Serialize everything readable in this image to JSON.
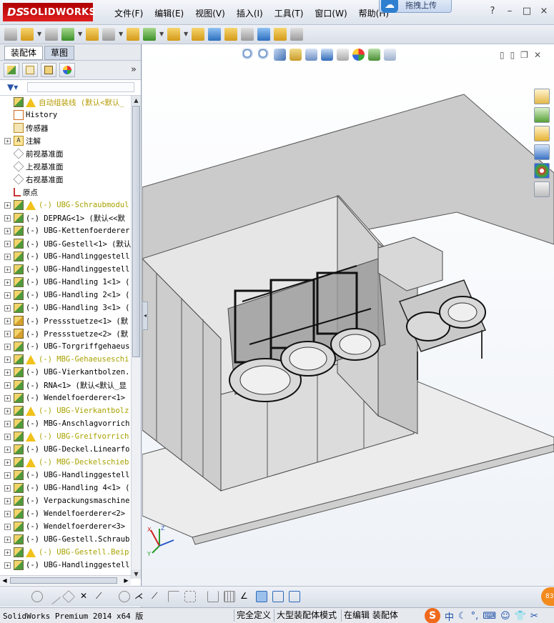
{
  "app": {
    "logo_prefix": "DS",
    "logo_name": "SOLIDWORKS",
    "upload_label": "拖拽上传"
  },
  "menu": [
    "文件(F)",
    "编辑(E)",
    "视图(V)",
    "插入(I)",
    "工具(T)",
    "窗口(W)",
    "帮助(H)"
  ],
  "title_controls": [
    "?",
    "–",
    "□",
    "×"
  ],
  "tabs": [
    {
      "label": "装配体",
      "state": "active"
    },
    {
      "label": "草图",
      "state": "selected"
    }
  ],
  "panel_expand_glyph": "»",
  "tree": {
    "root": {
      "label": "自动组装线  (默认<默认_",
      "warning": true
    },
    "items": [
      {
        "label": "History",
        "icon": "history-icon",
        "expand": false
      },
      {
        "label": "传感器",
        "icon": "sensor-icon",
        "expand": false
      },
      {
        "label": "注解",
        "icon": "annotation-icon",
        "expand": true
      },
      {
        "label": "前视基准面",
        "icon": "plane-icon",
        "expand": false
      },
      {
        "label": "上视基准面",
        "icon": "plane-icon",
        "expand": false
      },
      {
        "label": "右视基准面",
        "icon": "plane-icon",
        "expand": false
      },
      {
        "label": "原点",
        "icon": "origin-icon",
        "expand": false
      },
      {
        "label": "(-) UBG-Schraubmodul",
        "icon": "assembly-icon",
        "expand": true,
        "warning": true,
        "highlight": true
      },
      {
        "label": "(-) DEPRAG<1> (默认<<默",
        "icon": "assembly-icon",
        "expand": true
      },
      {
        "label": "(-) UBG-Kettenfoerderer",
        "icon": "assembly-icon",
        "expand": true
      },
      {
        "label": "(-) UBG-Gestell<1> (默认",
        "icon": "assembly-icon",
        "expand": true
      },
      {
        "label": "(-) UBG-Handlinggestell",
        "icon": "assembly-icon",
        "expand": true
      },
      {
        "label": "(-) UBG-Handlinggestell",
        "icon": "assembly-icon",
        "expand": true
      },
      {
        "label": "(-) UBG-Handling 1<1> (",
        "icon": "assembly-icon",
        "expand": true
      },
      {
        "label": "(-) UBG-Handling 2<1> (",
        "icon": "assembly-icon",
        "expand": true
      },
      {
        "label": "(-) UBG-Handling 3<1> (",
        "icon": "assembly-icon",
        "expand": true
      },
      {
        "label": "(-) Pressstuetze<1> (默",
        "icon": "part-icon",
        "expand": true
      },
      {
        "label": "(-) Pressstuetze<2> (默",
        "icon": "part-icon",
        "expand": true
      },
      {
        "label": "(-) UBG-Torgriffgehaeus",
        "icon": "assembly-icon",
        "expand": true
      },
      {
        "label": "(-) MBG-Gehaeuseschi",
        "icon": "assembly-icon",
        "expand": true,
        "warning": true,
        "highlight": true
      },
      {
        "label": "(-) UBG-Vierkantbolzen.",
        "icon": "assembly-icon",
        "expand": true
      },
      {
        "label": "(-) RNA<1> (默认<默认_显",
        "icon": "assembly-icon",
        "expand": true
      },
      {
        "label": "(-) Wendelfoerderer<1>",
        "icon": "assembly-icon",
        "expand": true
      },
      {
        "label": "(-) UBG-Vierkantbolz",
        "icon": "assembly-icon",
        "expand": true,
        "warning": true,
        "highlight": true
      },
      {
        "label": "(-) MBG-Anschlagvorrich",
        "icon": "assembly-icon",
        "expand": true
      },
      {
        "label": "(-) UBG-Greifvorrich",
        "icon": "assembly-icon",
        "expand": true,
        "warning": true,
        "highlight": true
      },
      {
        "label": "(-) UBG-Deckel.Linearfo",
        "icon": "assembly-icon",
        "expand": true
      },
      {
        "label": "(-) MBG-Deckelschieb",
        "icon": "assembly-icon",
        "expand": true,
        "warning": true,
        "highlight": true
      },
      {
        "label": "(-) UBG-Handlinggestell",
        "icon": "assembly-icon",
        "expand": true
      },
      {
        "label": "(-) UBG-Handling 4<1> (",
        "icon": "assembly-icon",
        "expand": true
      },
      {
        "label": "(-) Verpackungsmaschine",
        "icon": "assembly-icon",
        "expand": true
      },
      {
        "label": "(-) Wendelfoerderer<2>",
        "icon": "assembly-icon",
        "expand": true
      },
      {
        "label": "(-) Wendelfoerderer<3>",
        "icon": "assembly-icon",
        "expand": true
      },
      {
        "label": "(-) UBG-Gestell.Schraub",
        "icon": "assembly-icon",
        "expand": true
      },
      {
        "label": "(-) UBG-Gestell.Beip",
        "icon": "assembly-icon",
        "expand": true,
        "warning": true,
        "highlight": true
      },
      {
        "label": "(-) UBG-Handlinggestell",
        "icon": "assembly-icon",
        "expand": true
      }
    ]
  },
  "triad": {
    "x": "X",
    "y": "Y",
    "z": "Z"
  },
  "status": {
    "version": "SolidWorks Premium 2014 x64 版",
    "cells": [
      "完全定义",
      "大型装配体模式",
      "在编辑 装配体"
    ]
  },
  "ime": {
    "logo": "S",
    "lang": "中"
  },
  "badge": "83"
}
